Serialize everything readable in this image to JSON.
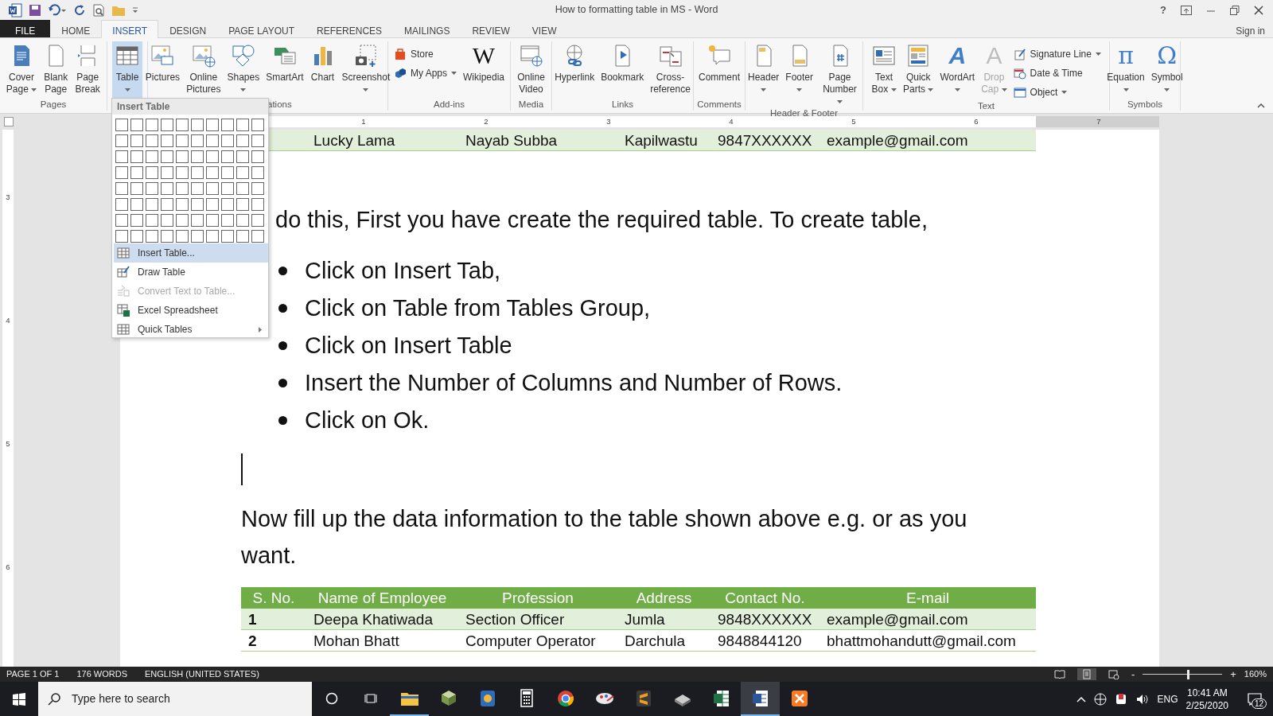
{
  "window": {
    "title": "How to formatting table in MS - Word",
    "help": "?"
  },
  "tabs": [
    {
      "label": "FILE",
      "kind": "file",
      "selected": false
    },
    {
      "label": "HOME",
      "kind": "tab",
      "selected": false
    },
    {
      "label": "INSERT",
      "kind": "tab",
      "selected": true
    },
    {
      "label": "DESIGN",
      "kind": "tab",
      "selected": false
    },
    {
      "label": "PAGE LAYOUT",
      "kind": "tab",
      "selected": false
    },
    {
      "label": "REFERENCES",
      "kind": "tab",
      "selected": false
    },
    {
      "label": "MAILINGS",
      "kind": "tab",
      "selected": false
    },
    {
      "label": "REVIEW",
      "kind": "tab",
      "selected": false
    },
    {
      "label": "VIEW",
      "kind": "tab",
      "selected": false
    }
  ],
  "sign_in": "Sign in",
  "ribbon": {
    "groups": [
      {
        "label": "Pages",
        "items": [
          {
            "kind": "large",
            "lines": [
              "Cover",
              "Page"
            ],
            "dropdown": true,
            "pressed": false,
            "disabled": false
          },
          {
            "kind": "large",
            "lines": [
              "Blank",
              "Page"
            ],
            "dropdown": false,
            "pressed": false,
            "disabled": false
          },
          {
            "kind": "large",
            "lines": [
              "Page",
              "Break"
            ],
            "dropdown": false,
            "pressed": false,
            "disabled": false
          }
        ]
      },
      {
        "items": [
          {
            "kind": "large",
            "lines": [
              "Table"
            ],
            "dropdown": true,
            "pressed": true,
            "disabled": false
          }
        ]
      },
      {
        "label": "ations",
        "items": [
          {
            "kind": "large",
            "lines": [
              "Pictures"
            ],
            "dropdown": false,
            "pressed": false,
            "disabled": false
          },
          {
            "kind": "large",
            "lines": [
              "Online",
              "Pictures"
            ],
            "dropdown": false,
            "pressed": false,
            "disabled": false
          },
          {
            "kind": "large",
            "lines": [
              "Shapes"
            ],
            "dropdown": true,
            "pressed": false,
            "disabled": false
          },
          {
            "kind": "large",
            "lines": [
              "SmartArt"
            ],
            "dropdown": false,
            "pressed": false,
            "disabled": false
          },
          {
            "kind": "large",
            "lines": [
              "Chart"
            ],
            "dropdown": false,
            "pressed": false,
            "disabled": false
          },
          {
            "kind": "large",
            "lines": [
              "Screenshot"
            ],
            "dropdown": true,
            "pressed": false,
            "disabled": false
          }
        ]
      },
      {
        "label": "Add-ins",
        "items": [
          {
            "kind": "small",
            "label": "Store",
            "dropdown": false
          },
          {
            "kind": "small",
            "label": "My Apps",
            "dropdown": true
          },
          {
            "kind": "large",
            "glyph": "W",
            "lines": [
              "Wikipedia"
            ],
            "dropdown": false,
            "pressed": false,
            "disabled": false
          }
        ]
      },
      {
        "label": "Media",
        "items": [
          {
            "kind": "large",
            "lines": [
              "Online",
              "Video"
            ],
            "dropdown": false,
            "pressed": false,
            "disabled": false
          }
        ]
      },
      {
        "label": "Links",
        "items": [
          {
            "kind": "large",
            "lines": [
              "Hyperlink"
            ],
            "dropdown": false,
            "pressed": false,
            "disabled": false
          },
          {
            "kind": "large",
            "lines": [
              "Bookmark"
            ],
            "dropdown": false,
            "pressed": false,
            "disabled": false
          },
          {
            "kind": "large",
            "lines": [
              "Cross-",
              "reference"
            ],
            "dropdown": false,
            "pressed": false,
            "disabled": false
          }
        ]
      },
      {
        "label": "Comments",
        "items": [
          {
            "kind": "large",
            "lines": [
              "Comment"
            ],
            "dropdown": false,
            "pressed": false,
            "disabled": false
          }
        ]
      },
      {
        "label": "Header & Footer",
        "items": [
          {
            "kind": "large",
            "lines": [
              "Header"
            ],
            "dropdown": true,
            "pressed": false,
            "disabled": false
          },
          {
            "kind": "large",
            "lines": [
              "Footer"
            ],
            "dropdown": true,
            "pressed": false,
            "disabled": false
          },
          {
            "kind": "large",
            "lines": [
              "Page",
              "Number"
            ],
            "dropdown": true,
            "pressed": false,
            "disabled": false
          }
        ]
      },
      {
        "label": "Text",
        "items": [
          {
            "kind": "large",
            "lines": [
              "Text",
              "Box"
            ],
            "dropdown": true,
            "pressed": false,
            "disabled": false
          },
          {
            "kind": "large",
            "lines": [
              "Quick",
              "Parts"
            ],
            "dropdown": true,
            "pressed": false,
            "disabled": false
          },
          {
            "kind": "large",
            "glyph": "A",
            "lines": [
              "WordArt"
            ],
            "dropdown": true,
            "pressed": false,
            "disabled": false
          },
          {
            "kind": "large",
            "glyph": "A",
            "lines": [
              "Drop",
              "Cap"
            ],
            "dropdown": true,
            "pressed": false,
            "disabled": true
          },
          {
            "kind": "small",
            "label": "Signature Line",
            "dropdown": true
          },
          {
            "kind": "small",
            "label": "Date & Time",
            "dropdown": false
          },
          {
            "kind": "small",
            "label": "Object",
            "dropdown": true
          }
        ]
      },
      {
        "label": "Symbols",
        "items": [
          {
            "kind": "large",
            "glyph": "π",
            "lines": [
              "Equation"
            ],
            "dropdown": true,
            "pressed": false,
            "disabled": false
          },
          {
            "kind": "large",
            "glyph": "Ω",
            "lines": [
              "Symbol"
            ],
            "dropdown": true,
            "pressed": false,
            "disabled": false
          }
        ]
      }
    ]
  },
  "table_menu": {
    "title": "Insert Table",
    "items": [
      {
        "label": "Insert Table...",
        "selected": true,
        "disabled": false,
        "submenu": false
      },
      {
        "label": "Draw Table",
        "selected": false,
        "disabled": false,
        "submenu": false
      },
      {
        "label": "Convert Text to Table...",
        "selected": false,
        "disabled": true,
        "submenu": false
      },
      {
        "label": "Excel Spreadsheet",
        "selected": false,
        "disabled": false,
        "submenu": false
      },
      {
        "label": "Quick Tables",
        "selected": false,
        "disabled": false,
        "submenu": true
      }
    ]
  },
  "rulers": {
    "horizontal": [
      "1",
      "2",
      "3",
      "4",
      "5",
      "6",
      "7"
    ],
    "vertical": [
      "3",
      "4",
      "5",
      "6"
    ]
  },
  "document": {
    "top_row": [
      "Lucky Lama",
      "Nayab Subba",
      "Kapilwastu",
      "9847XXXXXX",
      "example@gmail.com"
    ],
    "intro": "do this, First you have create the required table. To create table,",
    "steps": [
      "Click on Insert Tab,",
      "Click on Table from Tables Group,",
      "Click on Insert Table",
      "Insert the Number of Columns and Number of Rows.",
      "Click on Ok."
    ],
    "note": "Now fill up the data information to the table shown above e.g. or as you want.",
    "table": {
      "columns": [
        "S. No.",
        "Name of Employee",
        "Profession",
        "Address",
        "Contact No.",
        "E-mail"
      ],
      "rows": [
        [
          "1",
          "Deepa Khatiwada",
          "Section Officer",
          "Jumla",
          "9848XXXXXX",
          "example@gmail.com"
        ],
        [
          "2",
          "Mohan Bhatt",
          "Computer Operator",
          "Darchula",
          "9848844120",
          "bhattmohandutt@gmail.com"
        ]
      ]
    }
  },
  "status_bar": {
    "page": "PAGE 1 OF 1",
    "words": "176 WORDS",
    "language": "ENGLISH (UNITED STATES)",
    "views": [
      {
        "selected": false
      },
      {
        "selected": true
      },
      {
        "selected": false
      }
    ],
    "zoom": {
      "minus": "-",
      "plus": "+",
      "level": 0.56,
      "reading": "160%"
    }
  },
  "taskbar": {
    "search_placeholder": "Type here to search",
    "apps": [
      {
        "running": true,
        "selected": false
      },
      {
        "running": false,
        "selected": false
      },
      {
        "running": false,
        "selected": false
      },
      {
        "running": false,
        "selected": false
      },
      {
        "running": false,
        "selected": false
      },
      {
        "running": false,
        "selected": false
      },
      {
        "running": false,
        "selected": false
      },
      {
        "running": false,
        "selected": false
      },
      {
        "running": false,
        "selected": false
      },
      {
        "running": true,
        "selected": true
      },
      {
        "running": false,
        "selected": false
      }
    ],
    "language": "ENG",
    "time": "10:41 AM",
    "date": "2/25/2020",
    "notifications": "12"
  }
}
